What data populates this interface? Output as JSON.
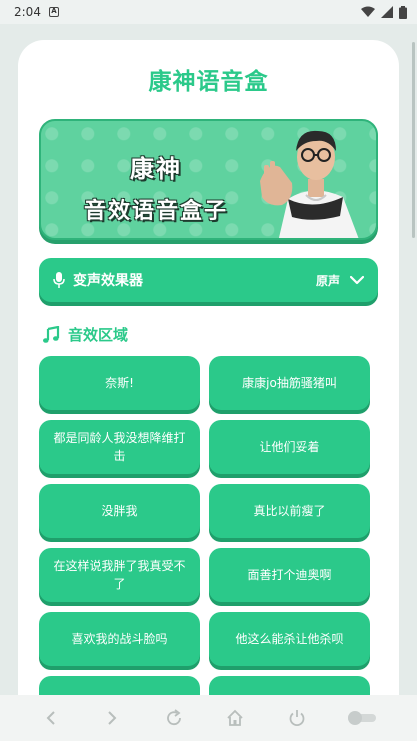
{
  "status_bar": {
    "time": "2:04",
    "notif_glyph": "A"
  },
  "app": {
    "title": "康神语音盒"
  },
  "banner": {
    "line1": "康神",
    "line2": "音效语音盒子"
  },
  "voice_changer": {
    "label": "变声效果器",
    "value": "原声",
    "icon": "microphone-icon",
    "chevron": "chevron-down-icon"
  },
  "section": {
    "title": "音效区域",
    "icon": "music-note-icon"
  },
  "sounds": [
    "奈斯!",
    "康康jo抽筋骚猪叫",
    "都是同龄人我没想降维打击",
    "让他们妥着",
    "没胖我",
    "真比以前瘦了",
    "在这样说我胖了我真受不了",
    "面善打个迪奥啊",
    "喜欢我的战斗脸吗",
    "他这么能杀让他杀呗",
    "",
    ""
  ],
  "nav": [
    "back-icon",
    "forward-icon",
    "refresh-icon",
    "home-icon",
    "power-icon",
    "toggle-icon"
  ],
  "colors": {
    "accent": "#2bc98a",
    "accent_dark": "#1f9f6b",
    "card_bg": "#ffffff",
    "page_bg": "#e4ebe9"
  }
}
